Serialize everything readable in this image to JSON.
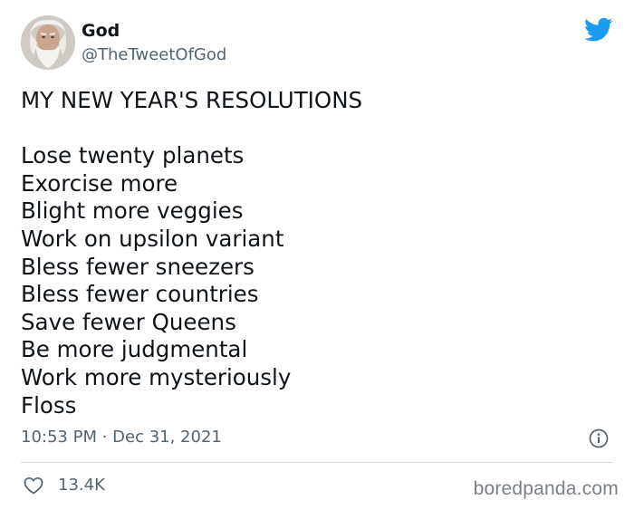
{
  "tweet": {
    "author_name": "God",
    "author_handle": "@TheTweetOfGod",
    "title": "MY NEW YEAR'S RESOLUTIONS",
    "lines": [
      "Lose twenty planets",
      "Exorcise more",
      "Blight more veggies",
      "Work on upsilon variant",
      "Bless fewer sneezers",
      "Bless fewer countries",
      "Save fewer Queens",
      "Be more judgmental",
      "Work more mysteriously",
      "Floss"
    ],
    "timestamp": "10:53 PM · Dec 31, 2021",
    "likes": "13.4K"
  },
  "watermark": "boredpanda.com",
  "icons": {
    "brand": "twitter-bird-icon",
    "info": "info-icon",
    "like": "heart-icon"
  },
  "colors": {
    "twitter_blue": "#1d9bf0",
    "text_primary": "#0f1419",
    "text_secondary": "#536471",
    "divider": "#cfd9de"
  }
}
